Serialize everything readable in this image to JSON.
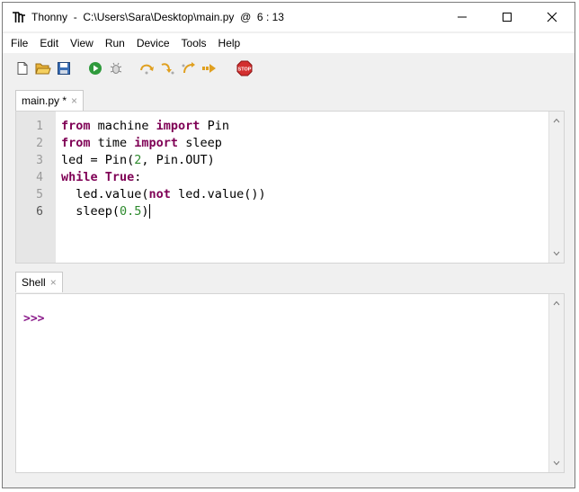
{
  "window": {
    "title": "Thonny  -  C:\\Users\\Sara\\Desktop\\main.py  @  6 : 13",
    "app_icon": "thonny-logo-icon"
  },
  "menu": [
    "File",
    "Edit",
    "View",
    "Run",
    "Device",
    "Tools",
    "Help"
  ],
  "toolbar": {
    "icons": [
      "new-file-icon",
      "open-folder-icon",
      "save-icon",
      "run-icon",
      "debug-icon",
      "step-over-icon",
      "step-into-icon",
      "step-out-icon",
      "resume-icon",
      "stop-icon"
    ],
    "stop_label": "STOP"
  },
  "editor_tab": {
    "label": "main.py *",
    "close": "×"
  },
  "editor": {
    "line_numbers": [
      "1",
      "2",
      "3",
      "4",
      "5",
      "6"
    ],
    "lines": [
      [
        {
          "t": "kw",
          "v": "from"
        },
        {
          "t": "p",
          "v": " machine "
        },
        {
          "t": "kw",
          "v": "import"
        },
        {
          "t": "p",
          "v": " Pin"
        }
      ],
      [
        {
          "t": "kw",
          "v": "from"
        },
        {
          "t": "p",
          "v": " time "
        },
        {
          "t": "kw",
          "v": "import"
        },
        {
          "t": "p",
          "v": " sleep"
        }
      ],
      [
        {
          "t": "p",
          "v": "led = Pin("
        },
        {
          "t": "num",
          "v": "2"
        },
        {
          "t": "p",
          "v": ", Pin.OUT)"
        }
      ],
      [
        {
          "t": "kw",
          "v": "while"
        },
        {
          "t": "p",
          "v": " "
        },
        {
          "t": "kw",
          "v": "True"
        },
        {
          "t": "p",
          "v": ":"
        }
      ],
      [
        {
          "t": "p",
          "v": "  led.value("
        },
        {
          "t": "kw",
          "v": "not"
        },
        {
          "t": "p",
          "v": " led.value())"
        }
      ],
      [
        {
          "t": "p",
          "v": "  sleep("
        },
        {
          "t": "num",
          "v": "0.5"
        },
        {
          "t": "p",
          "v": ")"
        }
      ]
    ],
    "current_line": 6
  },
  "shell_tab": {
    "label": "Shell",
    "close": "×"
  },
  "shell": {
    "prompt": ">>>"
  },
  "colors": {
    "keyword": "#7f0055",
    "number": "#2d8a2d",
    "prompt": "#8a1a8a",
    "gutter": "#e6e6e6"
  }
}
